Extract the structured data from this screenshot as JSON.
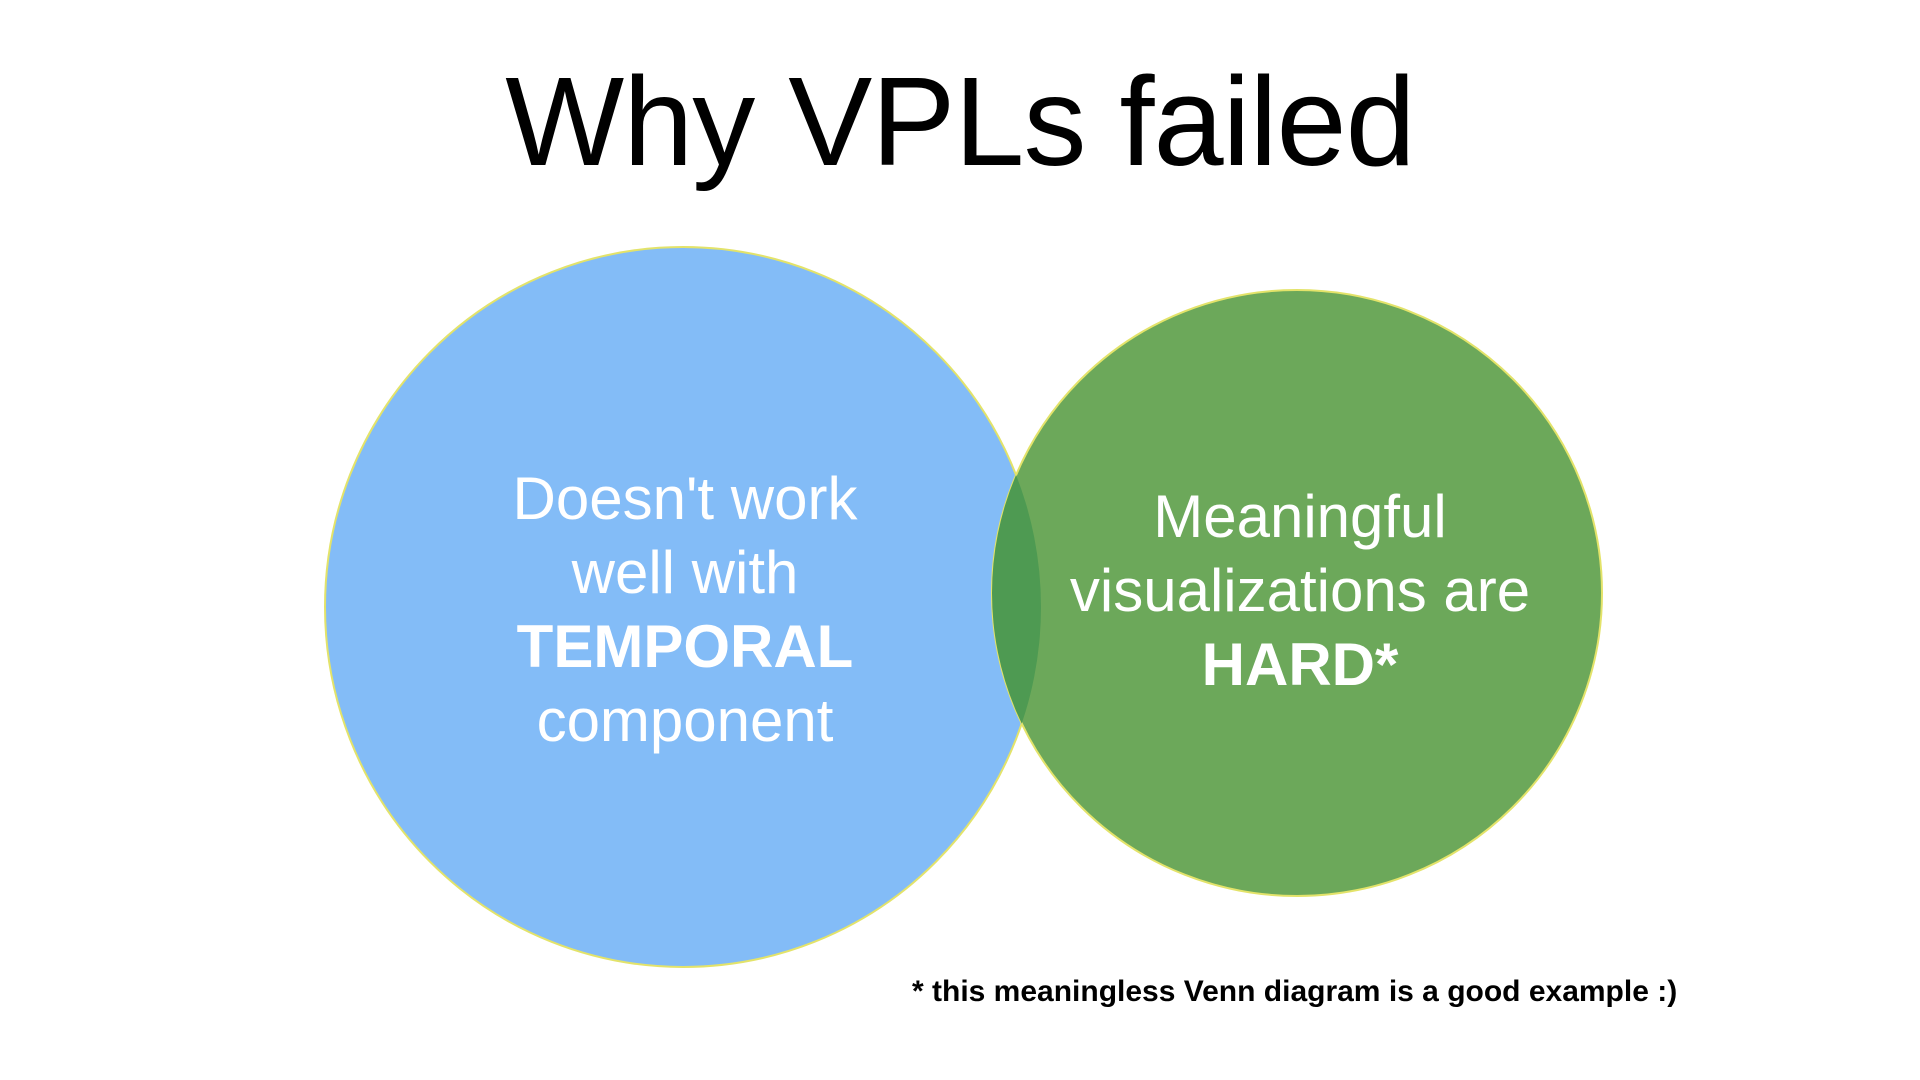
{
  "slide": {
    "title": "Why VPLs failed",
    "footnote": "* this meaningless Venn diagram is a good example :)"
  },
  "venn": {
    "left": {
      "line1": "Doesn't work",
      "line2": "well with",
      "emphasis": "TEMPORAL",
      "line4": "component",
      "fill": "#83BCF7"
    },
    "right": {
      "line1": "Meaningful",
      "line2": "visualizations are",
      "emphasis": "HARD*",
      "fill": "#6CA85A"
    },
    "overlap_fill": "#4E9A52",
    "outline": "#E3E36A"
  }
}
